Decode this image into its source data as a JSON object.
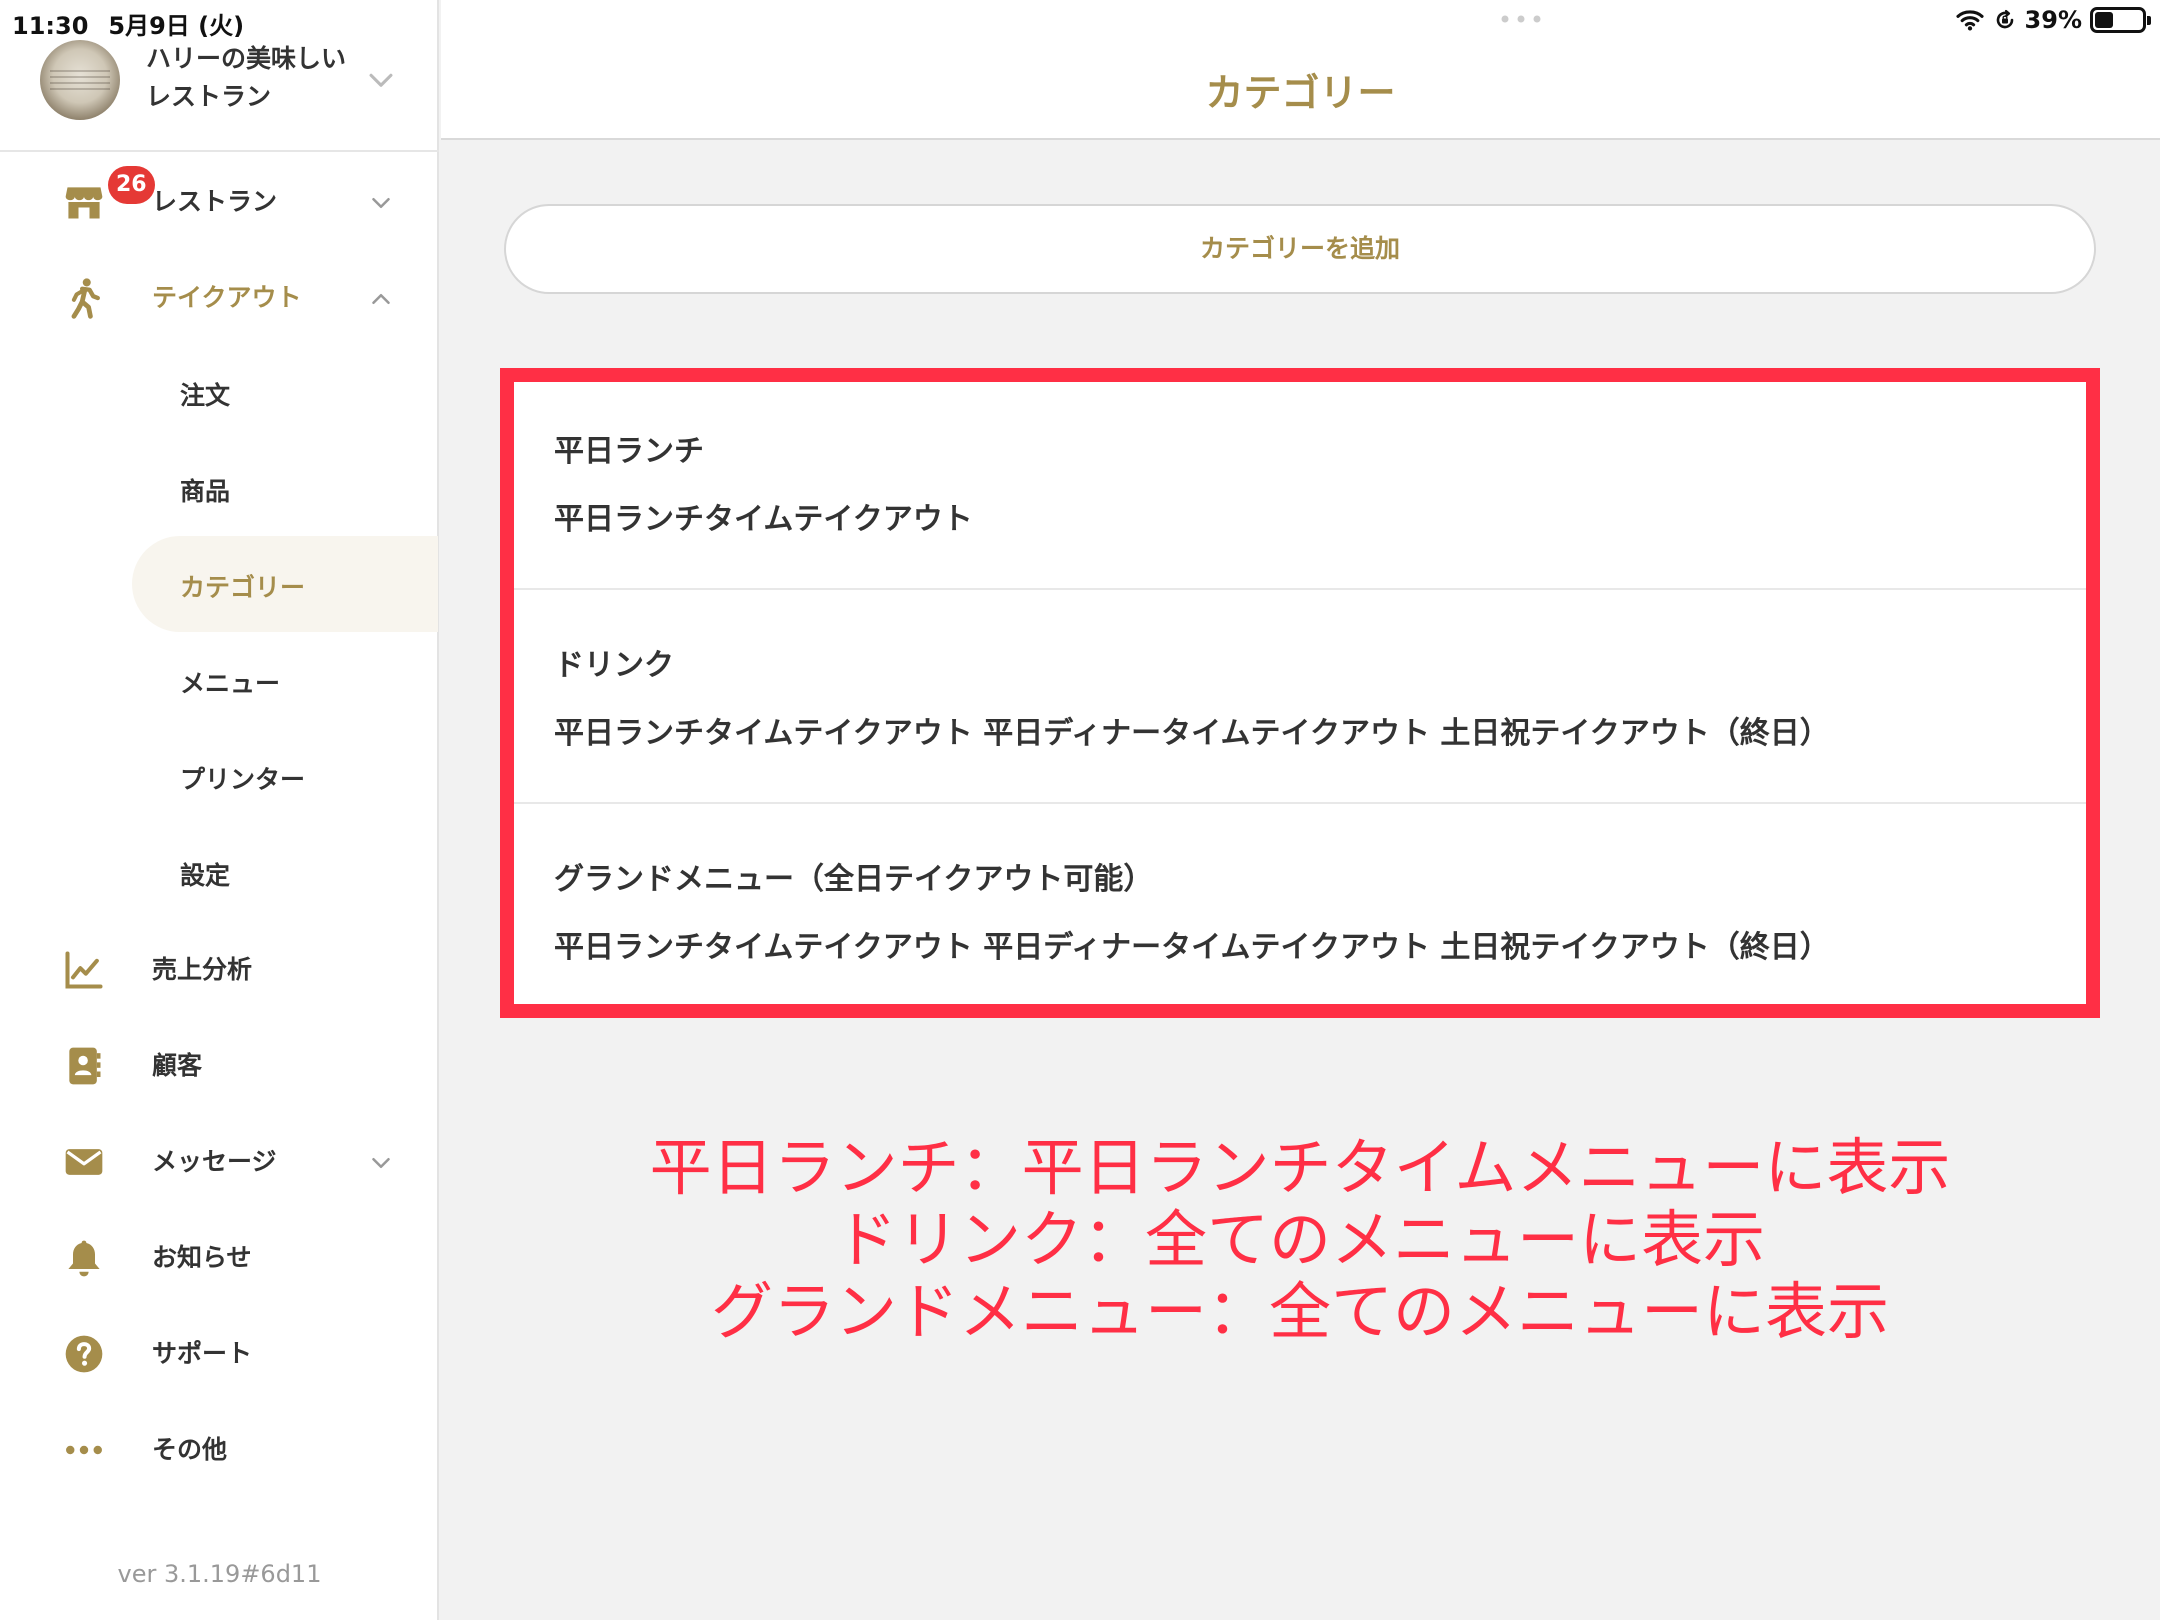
{
  "status_bar": {
    "time": "11:30",
    "date": "5月9日 (火)",
    "battery_pct": "39%",
    "battery_level": 0.39
  },
  "account": {
    "restaurant_name": "ハリーの美味しいレストラン"
  },
  "sidebar": {
    "badge_count": "26",
    "items": [
      {
        "label": "レストラン",
        "icon": "store-icon"
      },
      {
        "label": "テイクアウト",
        "icon": "walking-person-icon"
      },
      {
        "label": "売上分析",
        "icon": "chart-icon"
      },
      {
        "label": "顧客",
        "icon": "contact-book-icon"
      },
      {
        "label": "メッセージ",
        "icon": "envelope-icon"
      },
      {
        "label": "お知らせ",
        "icon": "bell-icon"
      },
      {
        "label": "サポート",
        "icon": "help-icon"
      },
      {
        "label": "その他",
        "icon": "more-icon"
      }
    ],
    "sub_items": [
      {
        "label": "注文"
      },
      {
        "label": "商品"
      },
      {
        "label": "カテゴリー"
      },
      {
        "label": "メニュー"
      },
      {
        "label": "プリンター"
      },
      {
        "label": "設定"
      }
    ],
    "version": "ver 3.1.19#6d11"
  },
  "header": {
    "title": "カテゴリー"
  },
  "add_button": {
    "label": "カテゴリーを追加"
  },
  "categories": [
    {
      "name": "平日ランチ",
      "menus": "平日ランチタイムテイクアウト"
    },
    {
      "name": "ドリンク",
      "menus": "平日ランチタイムテイクアウト 平日ディナータイムテイクアウト 土日祝テイクアウト（終日）"
    },
    {
      "name": "グランドメニュー（全日テイクアウト可能）",
      "menus": "平日ランチタイムテイクアウト 平日ディナータイムテイクアウト 土日祝テイクアウト（終日）"
    }
  ],
  "annotation": {
    "lines": [
      "平日ランチ：平日ランチタイムメニューに表示",
      "ドリンク：全てのメニューに表示",
      "グランドメニュー：全てのメニューに表示"
    ]
  },
  "colors": {
    "accent": "#a58d4b",
    "highlight": "#ff2f45",
    "badge": "#e53935"
  }
}
